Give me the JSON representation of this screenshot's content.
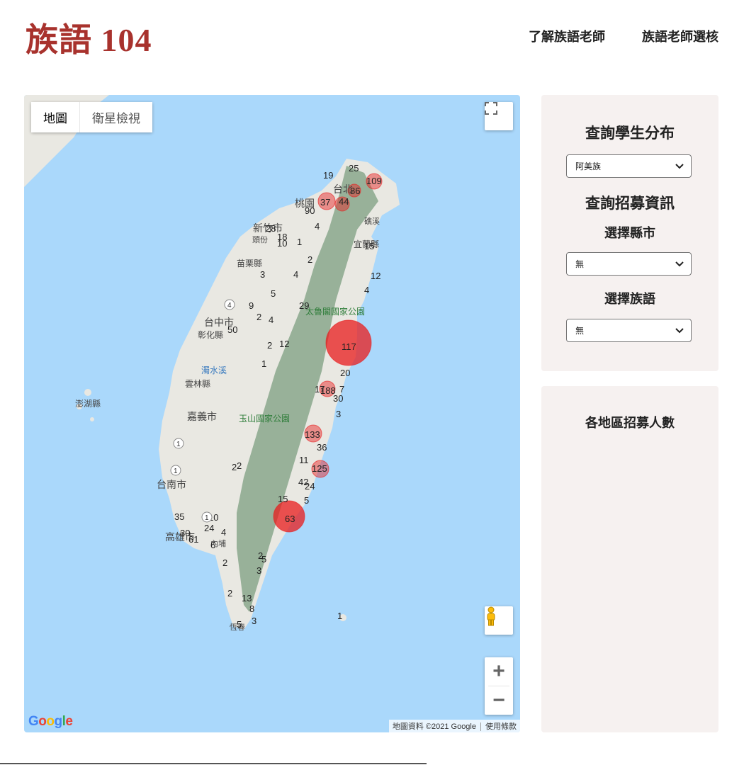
{
  "header": {
    "brand": "族語 104",
    "nav": [
      "了解族語老師",
      "族語老師選核"
    ]
  },
  "map": {
    "type_buttons": [
      "地圖",
      "衛星檢視"
    ],
    "place_labels": [
      "台北",
      "桃園",
      "新竹市",
      "頭份",
      "苗栗縣",
      "宜蘭縣",
      "礁溪",
      "台中市",
      "彰化縣",
      "雲林縣",
      "濁水溪",
      "澎湖縣",
      "嘉義市",
      "台南市",
      "高雄市",
      "玉山國家公園",
      "太魯閣國家公園",
      "恆春",
      "內埔"
    ],
    "road_badges": [
      "1",
      "4",
      "1",
      "1",
      "1",
      "1"
    ],
    "cluster_counts": [
      "25",
      "19",
      "109",
      "86",
      "44",
      "37",
      "90",
      "18",
      "10",
      "1",
      "4",
      "28",
      "2",
      "3",
      "4",
      "12",
      "15",
      "4",
      "5",
      "9",
      "29",
      "50",
      "2",
      "4",
      "12",
      "2",
      "1",
      "117",
      "20",
      "30",
      "17",
      "188",
      "3",
      "133",
      "36",
      "11",
      "125",
      "42",
      "24",
      "5",
      "15",
      "35",
      "10",
      "24",
      "30",
      "61",
      "63",
      "4",
      "2",
      "3",
      "5",
      "13",
      "8",
      "3",
      "5",
      "1",
      "6",
      "2",
      "2",
      "2",
      "7",
      "2"
    ],
    "google_logo": "Google",
    "attribution": [
      "地圖資料 ©2021 Google",
      "使用條款"
    ],
    "colors": {
      "sea": "#aad8fb",
      "land": "#e9e8e2",
      "mountain": "#8aa78c",
      "marker": "#e81c1c"
    }
  },
  "sidebar": {
    "query_students_title": "查詢學生分布",
    "tribe_select_value": "阿美族",
    "query_recruit_title": "查詢招募資訊",
    "county_label": "選擇縣市",
    "county_select_value": "無",
    "language_label": "選擇族語",
    "language_select_value": "無",
    "region_count_title": "各地區招募人數"
  }
}
